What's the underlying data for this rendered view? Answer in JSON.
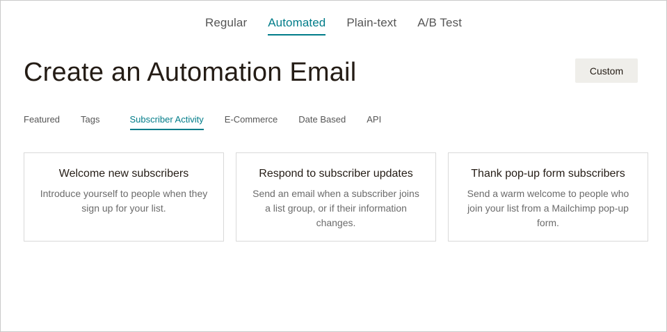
{
  "type_tabs": [
    {
      "label": "Regular"
    },
    {
      "label": "Automated"
    },
    {
      "label": "Plain-text"
    },
    {
      "label": "A/B Test"
    }
  ],
  "active_type_tab": "Automated",
  "page_title": "Create an Automation Email",
  "custom_button": "Custom",
  "category_tabs": [
    {
      "label": "Featured"
    },
    {
      "label": "Tags"
    },
    {
      "label": "Subscriber Activity"
    },
    {
      "label": "E-Commerce"
    },
    {
      "label": "Date Based"
    },
    {
      "label": "API"
    }
  ],
  "active_category_tab": "Subscriber Activity",
  "cards": [
    {
      "title": "Welcome new subscribers",
      "description": "Introduce yourself to people when they sign up for your list."
    },
    {
      "title": "Respond to subscriber updates",
      "description": "Send an email when a subscriber joins a list group, or if their information changes."
    },
    {
      "title": "Thank pop-up form subscribers",
      "description": "Send a warm welcome to people who join your list from a Mailchimp pop-up form."
    }
  ],
  "colors": {
    "accent": "#007c89",
    "text": "#241c15",
    "button_bg": "#efeeea"
  }
}
